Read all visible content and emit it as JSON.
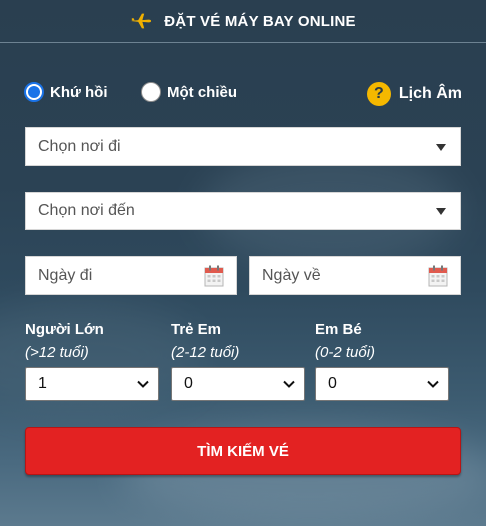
{
  "header": {
    "title": "ĐẶT VÉ MÁY BAY ONLINE",
    "icon": "plane-icon"
  },
  "trip_type": {
    "options": [
      {
        "label": "Khứ hồi",
        "checked": true
      },
      {
        "label": "Một chiều",
        "checked": false
      }
    ]
  },
  "lunar": {
    "label": "Lịch Âm",
    "icon_text": "?"
  },
  "origin": {
    "placeholder": "Chọn nơi đi"
  },
  "destination": {
    "placeholder": "Chọn nơi đến"
  },
  "depart_date": {
    "placeholder": "Ngày đi"
  },
  "return_date": {
    "placeholder": "Ngày về"
  },
  "passengers": [
    {
      "label": "Người Lớn",
      "age": "(>12 tuổi)",
      "value": "1"
    },
    {
      "label": "Trẻ Em",
      "age": "(2-12 tuổi)",
      "value": "0"
    },
    {
      "label": "Em Bé",
      "age": "(0-2 tuổi)",
      "value": "0"
    }
  ],
  "search_button": {
    "label": "TÌM KIẾM VÉ"
  },
  "colors": {
    "accent": "#e32222",
    "radio": "#1a73e8",
    "help": "#f5b800"
  }
}
